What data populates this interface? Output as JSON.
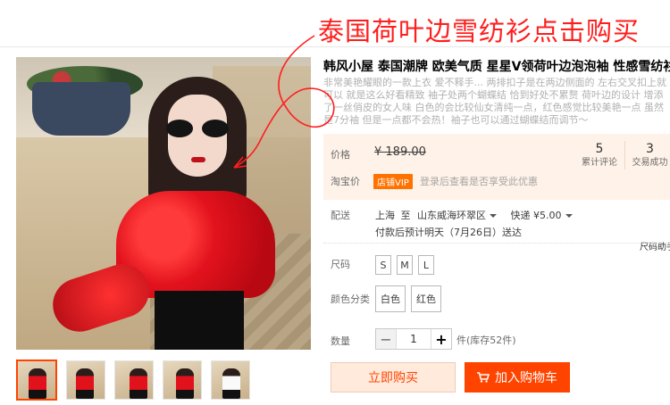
{
  "promo": {
    "title": "泰国荷叶边雪纺衫点击购买"
  },
  "product": {
    "title": "韩风小屋 泰国潮牌 欧美气质 星星V领荷叶边泡泡袖 性感雪纺衫",
    "description": "非常美艳耀眼的一款上衣 爱不释手... 两排扣子是在两边侧面的 左右交叉扣上就可以 就是这么好看精致 袖子处两个蝴蝶结 恰到好处不累赘 荷叶边的设计 增添了一丝俏皮的女人味 白色的会比较仙女清纯一点，红色感觉比较美艳一点 虽然是7分袖 但是一点都不会热！袖子也可以通过蝴蝶结而调节～"
  },
  "price_panel": {
    "price_label": "价格",
    "original_price": "¥ 189.00",
    "taobao_price_label": "淘宝价",
    "vip_badge": "店铺VIP",
    "vip_note": "登录后查看是否享受此优惠",
    "stats": [
      {
        "value": "5",
        "label": "累计评论"
      },
      {
        "value": "3",
        "label": "交易成功"
      }
    ]
  },
  "shipping": {
    "label": "配送",
    "from": "上海",
    "to_word": "至",
    "destination": "山东威海环翠区",
    "method": "快递 ¥5.00",
    "eta": "付款后预计明天（7月26日）送达"
  },
  "size_chart_link": "尺码助手",
  "size": {
    "label": "尺码",
    "options": [
      "S",
      "M",
      "L"
    ]
  },
  "color": {
    "label": "颜色分类",
    "options": [
      "白色",
      "红色"
    ]
  },
  "quantity": {
    "label": "数量",
    "value": "1",
    "minus": "−",
    "plus": "+",
    "stock": "件(库存52件)"
  },
  "actions": {
    "buy_now": "立即购买",
    "add_to_cart": "加入购物车"
  },
  "colors": {
    "accent": "#ff4400",
    "promo_red": "#ff1e1e",
    "panel_bg": "#fff2e8"
  }
}
